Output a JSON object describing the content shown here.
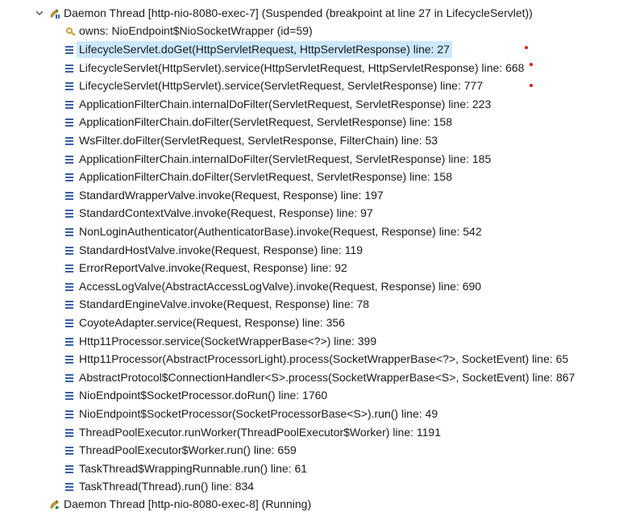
{
  "threads": [
    {
      "label": "Daemon Thread [http-nio-8080-exec-7] (Suspended (breakpoint at line 27 in LifecycleServlet))",
      "expanded": true,
      "state_icon": "thread-suspended-icon",
      "owns": "owns: NioEndpoint$NioSocketWrapper  (id=59)",
      "frames": [
        {
          "label": "LifecycleServlet.doGet(HttpServletRequest, HttpServletResponse) line: 27",
          "selected": true,
          "breakpoint": true
        },
        {
          "label": "LifecycleServlet(HttpServlet).service(HttpServletRequest, HttpServletResponse) line: 668",
          "breakpoint": true
        },
        {
          "label": "LifecycleServlet(HttpServlet).service(ServletRequest, ServletResponse) line: 777",
          "breakpoint": true
        },
        {
          "label": "ApplicationFilterChain.internalDoFilter(ServletRequest, ServletResponse) line: 223"
        },
        {
          "label": "ApplicationFilterChain.doFilter(ServletRequest, ServletResponse) line: 158"
        },
        {
          "label": "WsFilter.doFilter(ServletRequest, ServletResponse, FilterChain) line: 53"
        },
        {
          "label": "ApplicationFilterChain.internalDoFilter(ServletRequest, ServletResponse) line: 185"
        },
        {
          "label": "ApplicationFilterChain.doFilter(ServletRequest, ServletResponse) line: 158"
        },
        {
          "label": "StandardWrapperValve.invoke(Request, Response) line: 197"
        },
        {
          "label": "StandardContextValve.invoke(Request, Response) line: 97"
        },
        {
          "label": "NonLoginAuthenticator(AuthenticatorBase).invoke(Request, Response) line: 542"
        },
        {
          "label": "StandardHostValve.invoke(Request, Response) line: 119"
        },
        {
          "label": "ErrorReportValve.invoke(Request, Response) line: 92"
        },
        {
          "label": "AccessLogValve(AbstractAccessLogValve).invoke(Request, Response) line: 690"
        },
        {
          "label": "StandardEngineValve.invoke(Request, Response) line: 78"
        },
        {
          "label": "CoyoteAdapter.service(Request, Response) line: 356"
        },
        {
          "label": "Http11Processor.service(SocketWrapperBase<?>) line: 399"
        },
        {
          "label": "Http11Processor(AbstractProcessorLight).process(SocketWrapperBase<?>, SocketEvent) line: 65"
        },
        {
          "label": "AbstractProtocol$ConnectionHandler<S>.process(SocketWrapperBase<S>, SocketEvent) line: 867"
        },
        {
          "label": "NioEndpoint$SocketProcessor.doRun() line: 1760"
        },
        {
          "label": "NioEndpoint$SocketProcessor(SocketProcessorBase<S>).run() line: 49"
        },
        {
          "label": "ThreadPoolExecutor.runWorker(ThreadPoolExecutor$Worker) line: 1191"
        },
        {
          "label": "ThreadPoolExecutor$Worker.run() line: 659"
        },
        {
          "label": "TaskThread$WrappingRunnable.run() line: 61"
        },
        {
          "label": "TaskThread(Thread).run() line: 834"
        }
      ]
    },
    {
      "label": "Daemon Thread [http-nio-8080-exec-8] (Running)",
      "expanded": false,
      "state_icon": "thread-running-icon"
    }
  ],
  "colors": {
    "selection": "#cce8ff",
    "frame_icon": "#3a5ea8",
    "thread_icon": "#c9a23a",
    "breakpoint_marker": "#e0141e"
  }
}
